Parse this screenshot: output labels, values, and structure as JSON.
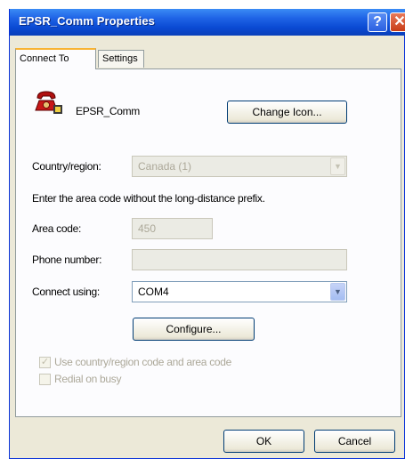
{
  "window": {
    "title": "EPSR_Comm Properties"
  },
  "titlebar": {
    "help_glyph": "?",
    "close_glyph": "✕"
  },
  "tabs": [
    {
      "label": "Connect To",
      "active": true
    },
    {
      "label": "Settings",
      "active": false
    }
  ],
  "connection": {
    "name": "EPSR_Comm",
    "change_icon_label": "Change Icon...",
    "icon": "phone-icon"
  },
  "country": {
    "label": "Country/region:",
    "value": "Canada (1)"
  },
  "instruction": "Enter the area code without the long-distance prefix.",
  "area_code": {
    "label": "Area code:",
    "value": "450"
  },
  "phone_number": {
    "label": "Phone number:",
    "value": ""
  },
  "connect_using": {
    "label": "Connect using:",
    "value": "COM4"
  },
  "configure_label": "Configure...",
  "options": {
    "use_country_codes": {
      "label": "Use country/region code and area code",
      "checked": true
    },
    "redial": {
      "label": "Redial on busy",
      "checked": false
    }
  },
  "footer": {
    "ok_label": "OK",
    "cancel_label": "Cancel"
  },
  "colors": {
    "titlebar": "#0a4ad3",
    "window_bg": "#ece9d8",
    "disabled_text": "#aca899"
  }
}
